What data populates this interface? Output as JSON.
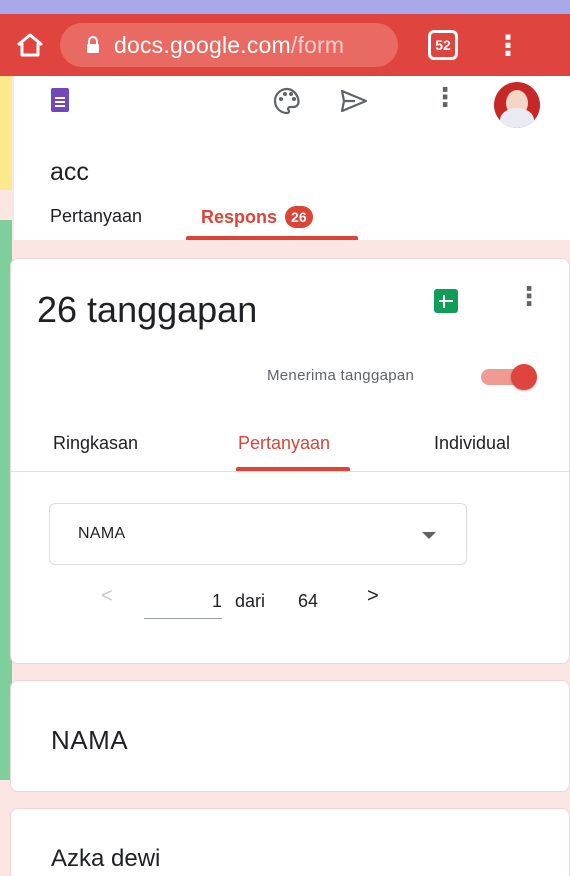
{
  "browser": {
    "url_domain": "docs.google.com",
    "url_path": "/form",
    "tab_count": "52"
  },
  "app": {
    "form_title": "acc",
    "tabs": [
      {
        "label": "Pertanyaan"
      },
      {
        "label": "Respons",
        "badge": "26"
      }
    ]
  },
  "summary": {
    "response_count_text": "26 tanggapan",
    "accepting_label": "Menerima tanggapan",
    "accepting": true,
    "subtabs": [
      "Ringkasan",
      "Pertanyaan",
      "Individual"
    ],
    "question_select": "NAMA",
    "pager": {
      "current": "1",
      "of_label": "dari",
      "total": "64"
    }
  },
  "question": {
    "title": "NAMA"
  },
  "answer": {
    "text": "Azka dewi"
  },
  "colors": {
    "accent": "#db4437",
    "browser_bar": "#e0443e",
    "forms_purple": "#7248b9",
    "sheets_green": "#0f9d58"
  }
}
